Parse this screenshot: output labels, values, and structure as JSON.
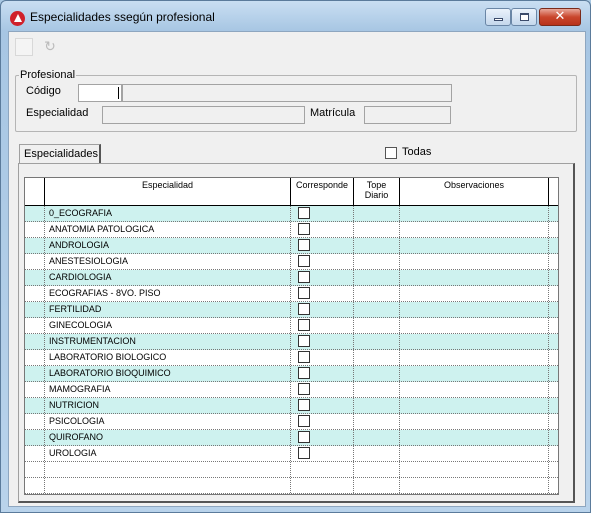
{
  "window": {
    "title": "Especialidades ssegún profesional"
  },
  "profesional": {
    "legend": "Profesional",
    "codigo_label": "Código",
    "codigo_value": "",
    "codigo_desc": "",
    "especialidad_label": "Especialidad",
    "especialidad_value": "",
    "matricula_label": "Matrícula",
    "matricula_value": ""
  },
  "tabs": {
    "especialidades_label": "Especialidades"
  },
  "todas": {
    "label": "Todas",
    "checked": false
  },
  "grid": {
    "columns": [
      "Especialidad",
      "Corresponde",
      "Tope Diario",
      "Observaciones"
    ],
    "rows": [
      {
        "especialidad": "0_ECOGRAFIA",
        "corresponde": false
      },
      {
        "especialidad": "ANATOMIA PATOLOGICA",
        "corresponde": false
      },
      {
        "especialidad": "ANDROLOGIA",
        "corresponde": false
      },
      {
        "especialidad": "ANESTESIOLOGIA",
        "corresponde": false
      },
      {
        "especialidad": "CARDIOLOGIA",
        "corresponde": false
      },
      {
        "especialidad": "ECOGRAFIAS - 8VO. PISO",
        "corresponde": false
      },
      {
        "especialidad": "FERTILIDAD",
        "corresponde": false
      },
      {
        "especialidad": "GINECOLOGIA",
        "corresponde": false
      },
      {
        "especialidad": "INSTRUMENTACION",
        "corresponde": false
      },
      {
        "especialidad": "LABORATORIO BIOLOGICO",
        "corresponde": false
      },
      {
        "especialidad": "LABORATORIO BIOQUIMICO",
        "corresponde": false
      },
      {
        "especialidad": "MAMOGRAFIA",
        "corresponde": false
      },
      {
        "especialidad": "NUTRICION",
        "corresponde": false
      },
      {
        "especialidad": "PSICOLOGIA",
        "corresponde": false
      },
      {
        "especialidad": "QUIROFANO",
        "corresponde": false
      },
      {
        "especialidad": "UROLOGIA",
        "corresponde": false
      }
    ]
  },
  "colors": {
    "row_alt": "#cef2ef",
    "close_button": "#c9462c"
  }
}
